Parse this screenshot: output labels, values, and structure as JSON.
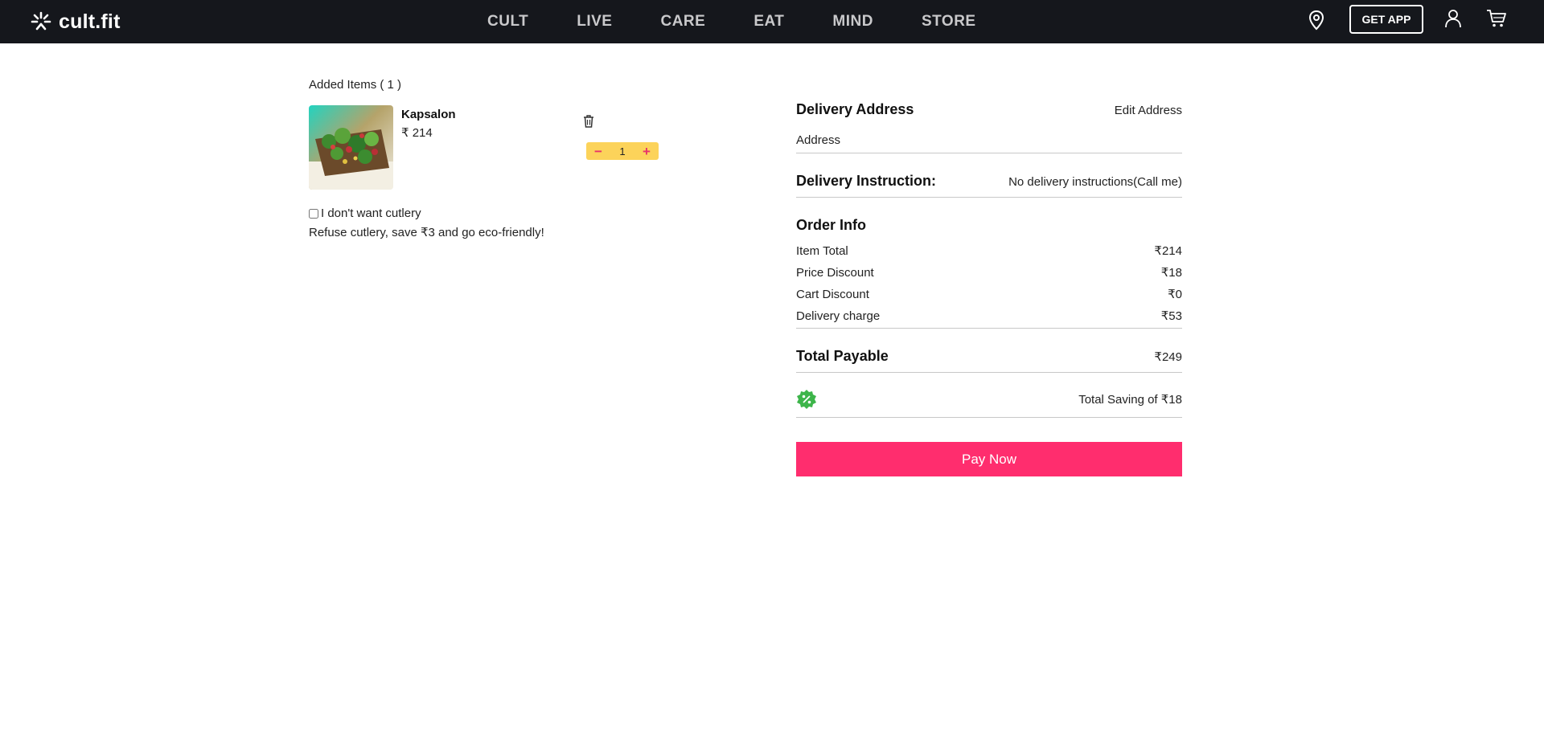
{
  "header": {
    "logo_text": "cult.fit",
    "logo_icon": "cult-fit-logo-icon",
    "nav": [
      "CULT",
      "LIVE",
      "CARE",
      "EAT",
      "MIND",
      "STORE"
    ],
    "get_app_label": "GET APP",
    "icons": [
      "location-pin-icon",
      "profile-icon",
      "cart-icon"
    ]
  },
  "cart": {
    "title": "Added Items ( 1 )",
    "items": [
      {
        "name": "Kapsalon",
        "price": "₹ 214",
        "quantity": "1",
        "image": "food-photo"
      }
    ],
    "cutlery_label": "I don't want cutlery",
    "cutlery_checked": false,
    "cutlery_note": "Refuse cutlery, save ₹3 and go eco-friendly!"
  },
  "summary": {
    "delivery_address_title": "Delivery Address",
    "edit_address_label": "Edit Address",
    "address_value": "Address",
    "delivery_instruction_title": "Delivery Instruction:",
    "delivery_instruction_value": "No delivery instructions(Call me)",
    "order_info_title": "Order Info",
    "lines": [
      {
        "label": "Item Total",
        "value": "₹214"
      },
      {
        "label": "Price Discount",
        "value": "₹18"
      },
      {
        "label": "Cart Discount",
        "value": "₹0"
      },
      {
        "label": "Delivery charge",
        "value": "₹53"
      }
    ],
    "total_label": "Total Payable",
    "total_value": "₹249",
    "saving_text": "Total Saving of ₹18",
    "pay_label": "Pay Now"
  },
  "colors": {
    "topbar": "#15171c",
    "accent_pink": "#ff2d6e",
    "stepper_yellow": "#fcd35a",
    "saving_green": "#3db54a"
  }
}
